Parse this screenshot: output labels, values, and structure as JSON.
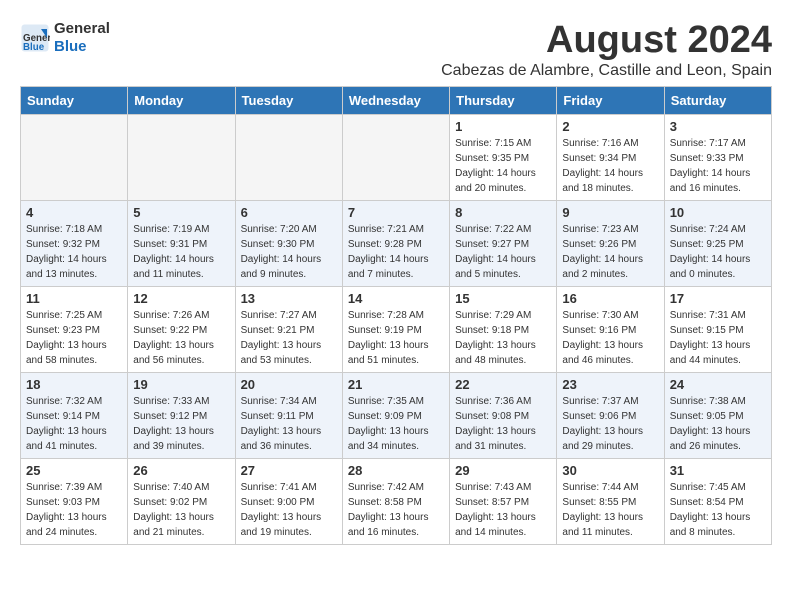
{
  "header": {
    "logo_line1": "General",
    "logo_line2": "Blue",
    "month_year": "August 2024",
    "location": "Cabezas de Alambre, Castille and Leon, Spain"
  },
  "columns": [
    "Sunday",
    "Monday",
    "Tuesday",
    "Wednesday",
    "Thursday",
    "Friday",
    "Saturday"
  ],
  "weeks": [
    [
      {
        "day": "",
        "empty": true
      },
      {
        "day": "",
        "empty": true
      },
      {
        "day": "",
        "empty": true
      },
      {
        "day": "",
        "empty": true
      },
      {
        "day": "1",
        "sunrise": "7:15 AM",
        "sunset": "9:35 PM",
        "daylight": "14 hours and 20 minutes."
      },
      {
        "day": "2",
        "sunrise": "7:16 AM",
        "sunset": "9:34 PM",
        "daylight": "14 hours and 18 minutes."
      },
      {
        "day": "3",
        "sunrise": "7:17 AM",
        "sunset": "9:33 PM",
        "daylight": "14 hours and 16 minutes."
      }
    ],
    [
      {
        "day": "4",
        "sunrise": "7:18 AM",
        "sunset": "9:32 PM",
        "daylight": "14 hours and 13 minutes."
      },
      {
        "day": "5",
        "sunrise": "7:19 AM",
        "sunset": "9:31 PM",
        "daylight": "14 hours and 11 minutes."
      },
      {
        "day": "6",
        "sunrise": "7:20 AM",
        "sunset": "9:30 PM",
        "daylight": "14 hours and 9 minutes."
      },
      {
        "day": "7",
        "sunrise": "7:21 AM",
        "sunset": "9:28 PM",
        "daylight": "14 hours and 7 minutes."
      },
      {
        "day": "8",
        "sunrise": "7:22 AM",
        "sunset": "9:27 PM",
        "daylight": "14 hours and 5 minutes."
      },
      {
        "day": "9",
        "sunrise": "7:23 AM",
        "sunset": "9:26 PM",
        "daylight": "14 hours and 2 minutes."
      },
      {
        "day": "10",
        "sunrise": "7:24 AM",
        "sunset": "9:25 PM",
        "daylight": "14 hours and 0 minutes."
      }
    ],
    [
      {
        "day": "11",
        "sunrise": "7:25 AM",
        "sunset": "9:23 PM",
        "daylight": "13 hours and 58 minutes."
      },
      {
        "day": "12",
        "sunrise": "7:26 AM",
        "sunset": "9:22 PM",
        "daylight": "13 hours and 56 minutes."
      },
      {
        "day": "13",
        "sunrise": "7:27 AM",
        "sunset": "9:21 PM",
        "daylight": "13 hours and 53 minutes."
      },
      {
        "day": "14",
        "sunrise": "7:28 AM",
        "sunset": "9:19 PM",
        "daylight": "13 hours and 51 minutes."
      },
      {
        "day": "15",
        "sunrise": "7:29 AM",
        "sunset": "9:18 PM",
        "daylight": "13 hours and 48 minutes."
      },
      {
        "day": "16",
        "sunrise": "7:30 AM",
        "sunset": "9:16 PM",
        "daylight": "13 hours and 46 minutes."
      },
      {
        "day": "17",
        "sunrise": "7:31 AM",
        "sunset": "9:15 PM",
        "daylight": "13 hours and 44 minutes."
      }
    ],
    [
      {
        "day": "18",
        "sunrise": "7:32 AM",
        "sunset": "9:14 PM",
        "daylight": "13 hours and 41 minutes."
      },
      {
        "day": "19",
        "sunrise": "7:33 AM",
        "sunset": "9:12 PM",
        "daylight": "13 hours and 39 minutes."
      },
      {
        "day": "20",
        "sunrise": "7:34 AM",
        "sunset": "9:11 PM",
        "daylight": "13 hours and 36 minutes."
      },
      {
        "day": "21",
        "sunrise": "7:35 AM",
        "sunset": "9:09 PM",
        "daylight": "13 hours and 34 minutes."
      },
      {
        "day": "22",
        "sunrise": "7:36 AM",
        "sunset": "9:08 PM",
        "daylight": "13 hours and 31 minutes."
      },
      {
        "day": "23",
        "sunrise": "7:37 AM",
        "sunset": "9:06 PM",
        "daylight": "13 hours and 29 minutes."
      },
      {
        "day": "24",
        "sunrise": "7:38 AM",
        "sunset": "9:05 PM",
        "daylight": "13 hours and 26 minutes."
      }
    ],
    [
      {
        "day": "25",
        "sunrise": "7:39 AM",
        "sunset": "9:03 PM",
        "daylight": "13 hours and 24 minutes."
      },
      {
        "day": "26",
        "sunrise": "7:40 AM",
        "sunset": "9:02 PM",
        "daylight": "13 hours and 21 minutes."
      },
      {
        "day": "27",
        "sunrise": "7:41 AM",
        "sunset": "9:00 PM",
        "daylight": "13 hours and 19 minutes."
      },
      {
        "day": "28",
        "sunrise": "7:42 AM",
        "sunset": "8:58 PM",
        "daylight": "13 hours and 16 minutes."
      },
      {
        "day": "29",
        "sunrise": "7:43 AM",
        "sunset": "8:57 PM",
        "daylight": "13 hours and 14 minutes."
      },
      {
        "day": "30",
        "sunrise": "7:44 AM",
        "sunset": "8:55 PM",
        "daylight": "13 hours and 11 minutes."
      },
      {
        "day": "31",
        "sunrise": "7:45 AM",
        "sunset": "8:54 PM",
        "daylight": "13 hours and 8 minutes."
      }
    ]
  ],
  "labels": {
    "sunrise": "Sunrise:",
    "sunset": "Sunset:",
    "daylight": "Daylight hours"
  }
}
